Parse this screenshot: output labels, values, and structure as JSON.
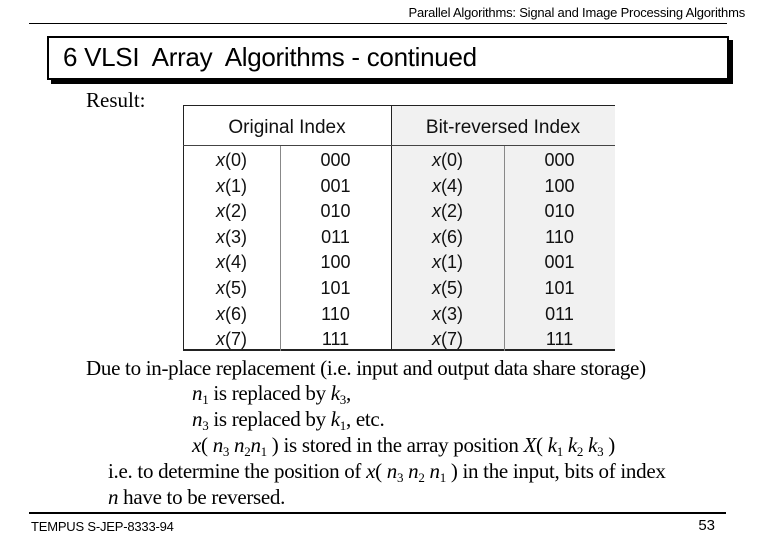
{
  "header": {
    "running_title": "Parallel Algorithms:  Signal and Image Processing Algorithms"
  },
  "slide": {
    "title": "6 VLSI  Array  Algorithms - continued",
    "result_label": "Result:"
  },
  "table": {
    "headers": [
      "Original Index",
      "Bit-reversed Index"
    ],
    "rows": [
      {
        "orig_x": "0",
        "orig_bits": "000",
        "rev_x": "0",
        "rev_bits": "000"
      },
      {
        "orig_x": "1",
        "orig_bits": "001",
        "rev_x": "4",
        "rev_bits": "100"
      },
      {
        "orig_x": "2",
        "orig_bits": "010",
        "rev_x": "2",
        "rev_bits": "010"
      },
      {
        "orig_x": "3",
        "orig_bits": "011",
        "rev_x": "6",
        "rev_bits": "110"
      },
      {
        "orig_x": "4",
        "orig_bits": "100",
        "rev_x": "1",
        "rev_bits": "001"
      },
      {
        "orig_x": "5",
        "orig_bits": "101",
        "rev_x": "5",
        "rev_bits": "101"
      },
      {
        "orig_x": "6",
        "orig_bits": "110",
        "rev_x": "3",
        "rev_bits": "011"
      },
      {
        "orig_x": "7",
        "orig_bits": "111",
        "rev_x": "7",
        "rev_bits": "111"
      }
    ]
  },
  "body": {
    "line1": "Due to in-place replacement (i.e. input and output data share storage)",
    "line2": {
      "var1": "n",
      "sub1": "1",
      "text": " is replaced by ",
      "var2": "k",
      "sub2": "3",
      "tail": ","
    },
    "line3": {
      "var1": "n",
      "sub1": "3",
      "text": " is replaced by ",
      "var2": "k",
      "sub2": "1",
      "tail": ", etc."
    },
    "line4": {
      "prefix": "x",
      "open": "( ",
      "vars": [
        {
          "v": "n",
          "s": "3"
        },
        {
          "v": "n",
          "s": "2"
        },
        {
          "v": "n",
          "s": "1"
        }
      ],
      "close": " )",
      "mid": " is stored in the array position ",
      "X": "X",
      "kvars": [
        {
          "v": "k",
          "s": "1"
        },
        {
          "v": "k",
          "s": "2"
        },
        {
          "v": "k",
          "s": "3"
        }
      ]
    },
    "line5": {
      "before": "i.e. to determine the position of ",
      "after": " in the input, bits of index"
    },
    "line6": {
      "var": "n",
      "text": " have to be reversed."
    }
  },
  "footer": {
    "left": "TEMPUS S-JEP-8333-94",
    "page_number": "53"
  }
}
